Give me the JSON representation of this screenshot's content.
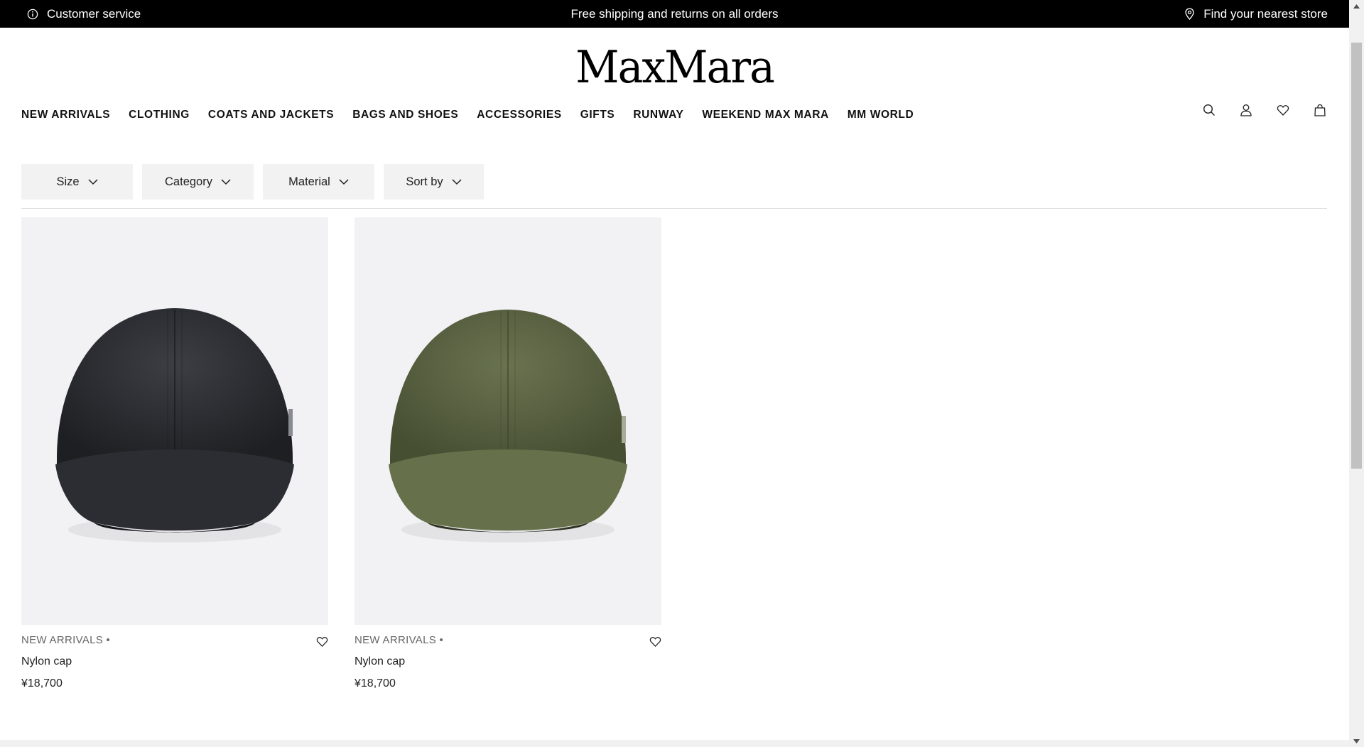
{
  "topbar": {
    "customer_service": "Customer service",
    "promo": "Free shipping and returns on all orders",
    "store_finder": "Find your nearest store"
  },
  "logo": {
    "text": "MaxMara"
  },
  "nav": {
    "items": [
      "NEW ARRIVALS",
      "CLOTHING",
      "COATS AND JACKETS",
      "BAGS AND SHOES",
      "ACCESSORIES",
      "GIFTS",
      "RUNWAY",
      "WEEKEND MAX MARA",
      "MM WORLD"
    ]
  },
  "header_icons": [
    "search-icon",
    "account-icon",
    "wishlist-icon",
    "bag-icon"
  ],
  "filters": {
    "size": "Size",
    "category": "Category",
    "material": "Material",
    "sort": "Sort by"
  },
  "products": [
    {
      "tag": "NEW ARRIVALS •",
      "name": "Nylon cap",
      "price": "¥18,700",
      "color": "#2a2b30"
    },
    {
      "tag": "NEW ARRIVALS •",
      "name": "Nylon cap",
      "price": "¥18,700",
      "color": "#5b6443"
    }
  ],
  "colors": {
    "topbar_bg": "#000000",
    "filter_bg": "#f2f2f2",
    "product_bg": "#f2f2f4"
  }
}
